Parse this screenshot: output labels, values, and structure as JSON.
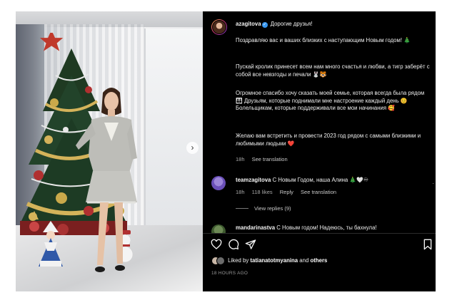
{
  "photo": {
    "next_icon": "chevron-right-icon"
  },
  "post": {
    "author": "azagitova",
    "greeting": "Дорогие друзья!",
    "paragraphs": [
      "Поздравляю вас и ваших близких с наступающим Новым годом! 🎄",
      "Пускай кролик принесет всем нам много счастья и любви, а тигр заберёт с собой все невзгоды и печали 🐰🐯",
      "Огромное спасибо хочу сказать моей семье, которая всегда была рядом 👪 Друзьям, которые поднимали мне настроение каждый день 😊 Болельщикам, которые поддерживали все мои начинания 🥰",
      "Желаю вам встретить и провести 2023 год рядом с самыми близкими и любимыми людьми ❤️"
    ],
    "time": "18h",
    "see_translation": "See translation"
  },
  "comments": [
    {
      "author": "teamzagitova",
      "text": "С Новым Годом, наша Алина 🎄🤍♾",
      "time": "18h",
      "likes": "118 likes",
      "reply": "Reply",
      "see_translation": "See translation",
      "view_replies": "View replies (9)"
    },
    {
      "author": "mandarinastva",
      "text": "С Новым годом! Надеюсь, ты бахнула!"
    }
  ],
  "actions": {
    "like_icon": "heart-icon",
    "comment_icon": "comment-icon",
    "share_icon": "send-icon",
    "save_icon": "bookmark-icon"
  },
  "likes": {
    "prefix": "Liked by",
    "user": "tatianatotmyanina",
    "connector": "and",
    "others": "others"
  },
  "timestamp": "18 HOURS AGO",
  "colors": {
    "panel_bg": "#000000",
    "verified": "#3897f0",
    "meta_text": "#a8a8a8"
  }
}
